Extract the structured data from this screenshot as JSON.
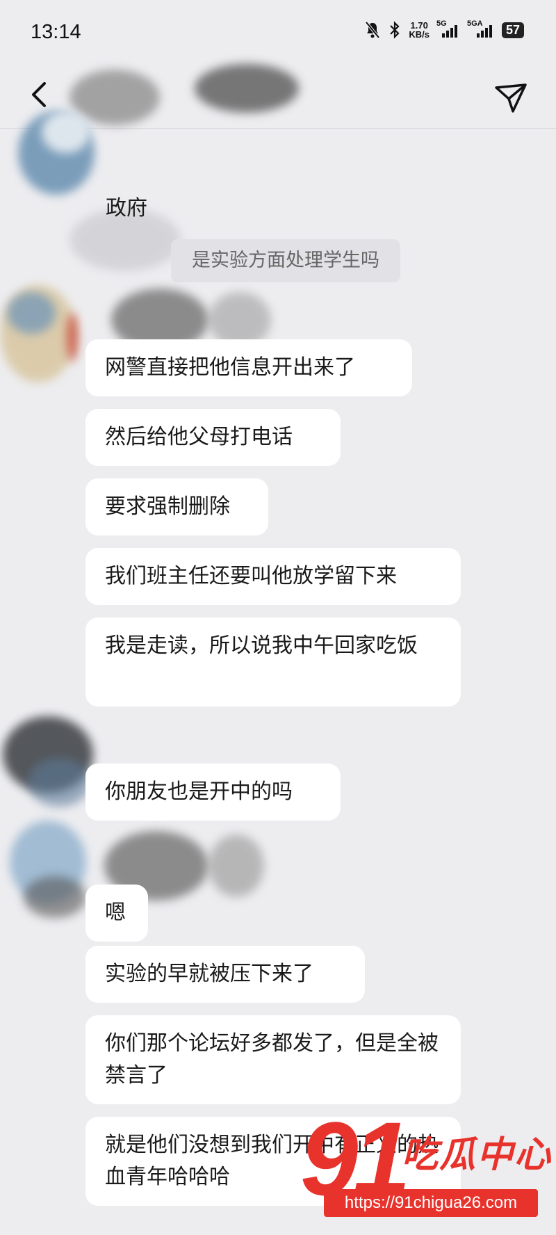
{
  "status_bar": {
    "time": "13:14",
    "net_speed_value": "1.70",
    "net_speed_unit": "KB/s",
    "signal1_label": "5G",
    "signal2_label": "5GA",
    "battery": "57"
  },
  "chat": {
    "header_fragment": "政府",
    "system_message": "是实验方面处理学生吗",
    "messages": [
      "网警直接把他信息开出来了",
      "然后给他父母打电话",
      "要求强制删除",
      "我们班主任还要叫他放学留下来",
      "我是走读，所以说我中午回家吃饭",
      "你朋友也是开中的吗",
      "嗯",
      "实验的早就被压下来了",
      "你们那个论坛好多都发了，但是全被禁言了",
      "就是他们没想到我们开中有正义的热血青年哈哈哈"
    ]
  },
  "watermark": {
    "number": "91",
    "brand": "吃瓜中心",
    "url": "https://91chigua26.com"
  }
}
